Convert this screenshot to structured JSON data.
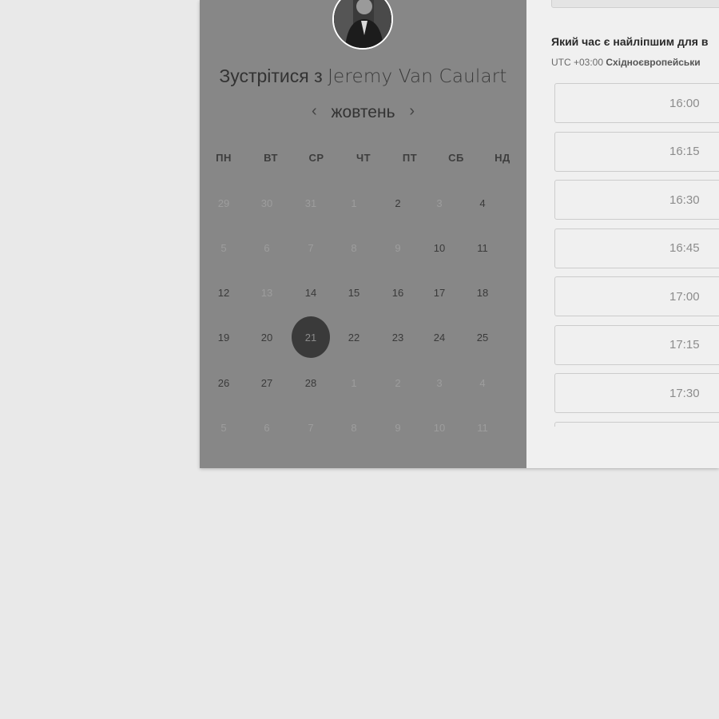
{
  "host": {
    "avatar_alt": "Jeremy Van Caulart",
    "meet_prefix": "Зустрітися з",
    "name": "Jeremy Van Caulart"
  },
  "calendar": {
    "prev_icon": "chevron-left-icon",
    "next_icon": "chevron-right-icon",
    "prev_glyph": "‹",
    "next_glyph": "›",
    "month": "жовтень",
    "weekdays": [
      "ПН",
      "ВТ",
      "СР",
      "ЧТ",
      "ПТ",
      "СБ",
      "НД"
    ],
    "weeks": [
      [
        {
          "d": "29",
          "m": true
        },
        {
          "d": "30",
          "m": true
        },
        {
          "d": "31",
          "m": true
        },
        {
          "d": "1",
          "m": true
        },
        {
          "d": "2",
          "m": false
        },
        {
          "d": "3",
          "m": true
        },
        {
          "d": "4",
          "m": false
        }
      ],
      [
        {
          "d": "5",
          "m": true
        },
        {
          "d": "6",
          "m": true
        },
        {
          "d": "7",
          "m": true
        },
        {
          "d": "8",
          "m": true
        },
        {
          "d": "9",
          "m": true
        },
        {
          "d": "10",
          "m": false
        },
        {
          "d": "11",
          "m": false
        }
      ],
      [
        {
          "d": "12",
          "m": false
        },
        {
          "d": "13",
          "m": true
        },
        {
          "d": "14",
          "m": false
        },
        {
          "d": "15",
          "m": false
        },
        {
          "d": "16",
          "m": false
        },
        {
          "d": "17",
          "m": false
        },
        {
          "d": "18",
          "m": false
        }
      ],
      [
        {
          "d": "19",
          "m": false
        },
        {
          "d": "20",
          "m": false
        },
        {
          "d": "21",
          "m": false,
          "s": true
        },
        {
          "d": "22",
          "m": false
        },
        {
          "d": "23",
          "m": false
        },
        {
          "d": "24",
          "m": false
        },
        {
          "d": "25",
          "m": false
        }
      ],
      [
        {
          "d": "26",
          "m": false
        },
        {
          "d": "27",
          "m": false
        },
        {
          "d": "28",
          "m": false
        },
        {
          "d": "1",
          "m": true
        },
        {
          "d": "2",
          "m": true
        },
        {
          "d": "3",
          "m": true
        },
        {
          "d": "4",
          "m": true
        }
      ],
      [
        {
          "d": "5",
          "m": true
        },
        {
          "d": "6",
          "m": true
        },
        {
          "d": "7",
          "m": true
        },
        {
          "d": "8",
          "m": true
        },
        {
          "d": "9",
          "m": true
        },
        {
          "d": "10",
          "m": true
        },
        {
          "d": "11",
          "m": true
        }
      ]
    ]
  },
  "times": {
    "question": "Який час є найліпшим для в",
    "tz_offset": "UTC +03:00",
    "tz_name": "Східноєвропейськи",
    "slots": [
      "16:00",
      "16:15",
      "16:30",
      "16:45",
      "17:00",
      "17:15",
      "17:30",
      ""
    ]
  },
  "colors": {
    "background": "#e9e9e9",
    "calendar_panel": "#878787",
    "times_panel": "#f0f0f0",
    "selected_day": "#3a3a3a"
  }
}
